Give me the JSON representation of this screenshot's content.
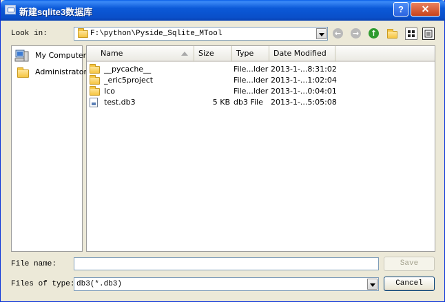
{
  "window": {
    "title": "新建sqlite3数据库",
    "help_label": "?",
    "close_label": "✕"
  },
  "look_in": {
    "label": "Look in:",
    "path": "F:\\python\\Pyside_Sqlite_MTool"
  },
  "sidebar": {
    "items": [
      {
        "label": "My Computer",
        "icon": "computer-icon"
      },
      {
        "label": "Administrator",
        "icon": "folder-icon"
      }
    ]
  },
  "columns": [
    "Name",
    "Size",
    "Type",
    "Date Modified"
  ],
  "files": [
    {
      "name": "__pycache__",
      "size": "",
      "type": "File...lder",
      "modified": "2013-1-...8:31:02",
      "icon": "folder-icon"
    },
    {
      "name": "_eric5project",
      "size": "",
      "type": "File...lder",
      "modified": "2013-1-...1:02:04",
      "icon": "folder-icon"
    },
    {
      "name": "Ico",
      "size": "",
      "type": "File...lder",
      "modified": "2013-1-...0:04:01",
      "icon": "folder-icon"
    },
    {
      "name": "test.db3",
      "size": "5 KB",
      "type": "db3 File",
      "modified": "2013-1-...5:05:08",
      "icon": "db-file-icon"
    }
  ],
  "file_name": {
    "label": "File name:",
    "value": ""
  },
  "file_type": {
    "label": "Files of type:",
    "value": "db3(*.db3)"
  },
  "buttons": {
    "save": "Save",
    "cancel": "Cancel"
  },
  "colors": {
    "titlebar": "#0b59d8",
    "dialog_bg": "#ece9d8",
    "list_bg": "#ffffff"
  }
}
